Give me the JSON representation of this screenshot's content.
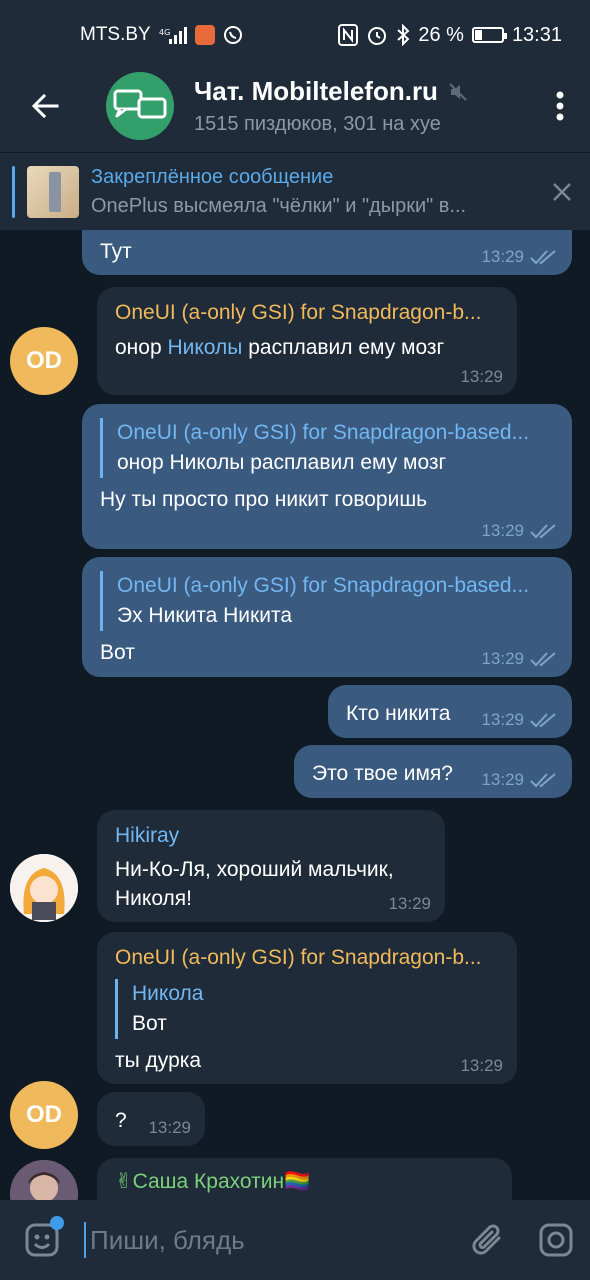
{
  "status_bar": {
    "carrier": "MTS.BY",
    "battery": "26 %",
    "battery_level": 0.26,
    "time": "13:31"
  },
  "header": {
    "title": "Чат. Mobiltelefon.ru",
    "subtitle": "1515 пиздюков, 301 на хуе"
  },
  "pinned": {
    "title": "Закреплённое сообщение",
    "preview": "OnePlus высмеяла \"чёлки\" и \"дырки\" в..."
  },
  "messages": [
    {
      "text": "Тут",
      "time": "13:29"
    },
    {
      "sender": "OneUI (a-only GSI) for Snapdragon-b...",
      "avatar": "OD",
      "text_pre": "онор ",
      "text_link": "Николы",
      "text_post": " расплавил ему мозг",
      "time": "13:29"
    },
    {
      "reply_title": "OneUI (a-only GSI) for Snapdragon-based...",
      "reply_text": "онор Николы расплавил ему мозг",
      "text": "Ну ты просто про никит говоришь",
      "time": "13:29"
    },
    {
      "reply_title": "OneUI (a-only GSI) for Snapdragon-based...",
      "reply_text": "Эх Никита Никита",
      "text": "Вот",
      "time": "13:29"
    },
    {
      "text": "Кто никита",
      "time": "13:29"
    },
    {
      "text": "Это твое имя?",
      "time": "13:29"
    },
    {
      "sender": "Hikiray",
      "text": "Ни-Ко-Ля, хороший мальчик, Николя!",
      "time": "13:29"
    },
    {
      "sender": "OneUI (a-only GSI) for Snapdragon-b...",
      "reply_title": "Никола",
      "reply_text": "Вот",
      "text": "ты дурка",
      "time": "13:29"
    },
    {
      "avatar": "OD",
      "text": "?",
      "time": "13:29"
    },
    {
      "sender": "✌Саша Крахотин🏳️‍🌈"
    }
  ],
  "input": {
    "placeholder": "Пиши, блядь"
  },
  "colors": {
    "background": "#0f1a24",
    "bar": "#1f2b38",
    "outgoing_bubble": "#3a5a80",
    "incoming_bubble": "#1f2b38",
    "accent": "#5aa9ea",
    "od_avatar": "#f0b95b",
    "chat_avatar": "#33a06b"
  },
  "icons": [
    "back-arrow-icon",
    "chat-bubbles-icon",
    "mute-icon",
    "more-vert-icon",
    "close-icon",
    "double-check-icon",
    "emoji-icon",
    "paperclip-icon",
    "instagram-camera-icon"
  ]
}
